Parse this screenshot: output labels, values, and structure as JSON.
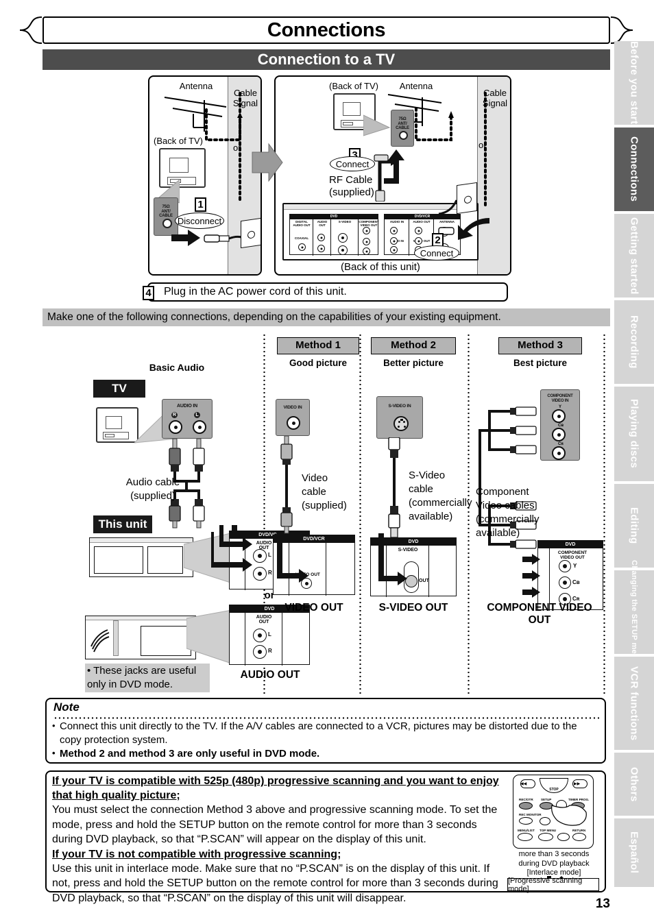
{
  "header": {
    "chapter_title": "Connections",
    "section_title": "Connection to a TV"
  },
  "antenna_diagram": {
    "left_panel": {
      "antenna_label": "Antenna",
      "cable_signal_label": "Cable\nSignal",
      "back_of_tv_label": "(Back of TV)",
      "or_label": "or",
      "jack_label": "75Ω\nANT/\nCABLE",
      "step_number": "1",
      "step_action": "Disconnect"
    },
    "right_panel": {
      "back_of_tv_label": "(Back of TV)",
      "antenna_label": "Antenna",
      "cable_signal_label": "Cable\nSignal",
      "or_label": "or",
      "jack_label": "75Ω\nANT/\nCABLE",
      "step3_number": "3",
      "step3_action": "Connect",
      "rf_cable_label": "RF Cable\n(supplied)",
      "step2_number": "2",
      "step2_action": "Connect",
      "back_of_unit_label": "(Back of this unit)",
      "rear_panel_dvd": {
        "header": "DVD",
        "cells": [
          {
            "label": "DIGITAL\nAUDIO OUT",
            "sub": "COAXIAL"
          },
          {
            "label": "AUDIO\nOUT",
            "sub": "L / R"
          },
          {
            "label": "S-VIDEO",
            "sub": "IN / OUT"
          },
          {
            "label": "COMPONENT\nVIDEO OUT",
            "sub": "Y / Cʙ / Cʀ"
          }
        ]
      },
      "rear_panel_dvdvcr": {
        "header": "DVD/VCR",
        "cells": [
          {
            "label": "AUDIO IN",
            "sub": "L / R"
          },
          {
            "label": "AUDIO OUT",
            "sub": "L / R"
          },
          {
            "label": "ANTENNA",
            "sub": "IN / OUT"
          }
        ],
        "video_in": "VIDEO IN",
        "video_out": "VIDEO OUT"
      }
    }
  },
  "step4": {
    "number": "4",
    "text": "Plug in the AC power cord of this unit."
  },
  "instruction_bar": {
    "text": "Make one of the following connections, depending on the capabilities of your existing equipment."
  },
  "methods": {
    "basic_audio": {
      "title": "Basic Audio",
      "tv_tag": "TV",
      "this_unit_tag": "This unit",
      "jack_panel_label": "AUDIO IN",
      "jack_r": "R",
      "jack_l": "L",
      "cable_label": "Audio cable\n(supplied)",
      "or_label": "or",
      "rear_tag_dvdvcr": "DVD/VCR",
      "rear_tag_dvd": "DVD",
      "rear_jack_label": "AUDIO\nOUT",
      "note": "• These jacks are useful\n   only in DVD mode.",
      "out_caption": "AUDIO OUT"
    },
    "method1": {
      "header": "Method 1",
      "subtitle": "Good picture",
      "jack_panel_label": "VIDEO IN",
      "cable_label": "Video\ncable\n(supplied)",
      "rear_tag": "DVD/VCR",
      "rear_jack_label": "VIDEO OUT",
      "out_caption": "VIDEO OUT"
    },
    "method2": {
      "header": "Method 2",
      "subtitle": "Better picture",
      "jack_panel_label": "S-VIDEO IN",
      "cable_label": "S-Video\ncable\n(commercially\navailable)",
      "rear_tag": "DVD",
      "rear_jack_label": "S-VIDEO",
      "rear_jack_sub": "OUT",
      "out_caption": "S-VIDEO OUT"
    },
    "method3": {
      "header": "Method 3",
      "subtitle": "Best picture",
      "jack_panel_label": "COMPONENT\nVIDEO IN",
      "jack_y": "Y",
      "jack_cb": "Cʙ",
      "jack_cr": "Cʀ",
      "cable_label": "Component\nVideo cables\n(commercially\navailable)",
      "rear_tag": "DVD",
      "rear_jack_label": "COMPONENT\nVIDEO OUT",
      "out_caption": "COMPONENT VIDEO OUT"
    }
  },
  "note": {
    "title": "Note",
    "items": [
      "Connect this unit directly to the TV. If the A/V cables are connected to a VCR, pictures may be distorted due to the copy protection system.",
      "Method 2 and method 3 are only useful in DVD mode."
    ]
  },
  "progressive": {
    "heading1": "If your TV is compatible with 525p (480p) progressive scanning and you want to enjoy that high quality picture;",
    "body1": "You must select the connection Method 3 above and progressive scanning mode. To set the mode, press and hold the SETUP button on the remote control for more than 3 seconds during DVD playback, so that “P.SCAN” will appear on the display of this unit.",
    "heading2": "If your TV is not compatible with progressive scanning;",
    "body2": "Use this unit in interlace mode. Make sure that no “P.SCAN” is on the display of this unit. If not, press and hold the SETUP button on the remote control for more than 3 seconds during DVD playback, so that “P.SCAN” on the display of this unit will disappear.",
    "remote": {
      "buttons": [
        "REC/OTR",
        "SETUP",
        "TIMER PROG.",
        "REC MONITOR",
        "MENU/LIST",
        "TOP MENU",
        "RETURN"
      ],
      "stop_label": "STOP",
      "caption": "more than 3 seconds\nduring DVD playback\n[Interlace mode]",
      "mode_box": "[Progressive scanning mode]"
    }
  },
  "side_tabs": [
    {
      "label": "Before you start",
      "active": false
    },
    {
      "label": "Connections",
      "active": true
    },
    {
      "label": "Getting started",
      "active": false
    },
    {
      "label": "Recording",
      "active": false
    },
    {
      "label": "Playing discs",
      "active": false
    },
    {
      "label": "Editing",
      "active": false
    },
    {
      "label": "Changing the SETUP menu",
      "active": false
    },
    {
      "label": "VCR functions",
      "active": false
    },
    {
      "label": "Others",
      "active": false
    },
    {
      "label": "Español",
      "active": false
    }
  ],
  "page_number": "13",
  "colors": {
    "section_bar": "#4d4d4d",
    "active_tab": "#5c5c5c",
    "inactive_tab": "#d5d5d5",
    "grey_bar": "#c0c0c0",
    "method_header": "#b4b4b4"
  }
}
